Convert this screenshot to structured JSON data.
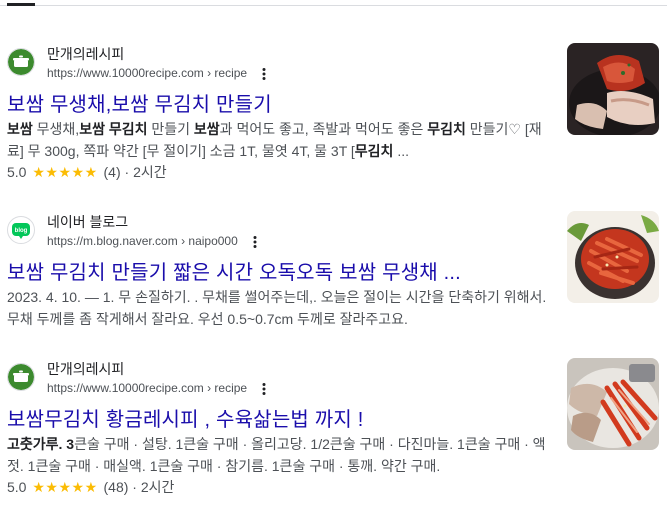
{
  "results": [
    {
      "site_name": "만개의레시피",
      "url": "https://www.10000recipe.com › recipe",
      "favicon": "recipe-pot-icon",
      "title": "보쌈 무생채,보쌈 무김치 만들기",
      "snippet_parts": [
        {
          "t": "보쌈",
          "b": true
        },
        {
          "t": " 무생채,",
          "b": false
        },
        {
          "t": "보쌈 무김치",
          "b": true
        },
        {
          "t": " 만들기 ",
          "b": false
        },
        {
          "t": "보쌈",
          "b": true
        },
        {
          "t": "과 먹어도 좋고, 족발과 먹어도 좋은 ",
          "b": false
        },
        {
          "t": "무김치",
          "b": true
        },
        {
          "t": " 만들기♡ [재료] 무 300g, 쪽파 약간 [무 절이기] 소금 1T, 물엿 4T, 물 3T [",
          "b": false
        },
        {
          "t": "무김치",
          "b": true
        },
        {
          "t": " ...",
          "b": false
        }
      ],
      "rating": "5.0",
      "stars": "★★★★★",
      "reviews": "(4) · 2시간",
      "thumbnail": "bossam-kimchi-photo"
    },
    {
      "site_name": "네이버 블로그",
      "url": "https://m.blog.naver.com › naipo000",
      "favicon": "naver-blog-icon",
      "favicon_text": "blog",
      "title": "보쌈 무김치 만들기 짧은 시간 오독오독 보쌈 무생채 ...",
      "snippet_parts": [
        {
          "t": "2023. 4. 10. — 1. 무 손질하기. . 무채를 썰어주는데,. 오늘은 절이는 시간을 단축하기 위해서. 무채 두께를 좀 작게해서 잘라요. 우선 0.5~0.7cm 두께로 잘라주고요.",
          "b": false
        }
      ],
      "thumbnail": "radish-kimchi-bowl-photo"
    },
    {
      "site_name": "만개의레시피",
      "url": "https://www.10000recipe.com › recipe",
      "favicon": "recipe-pot-icon",
      "title": "보쌈무김치 황금레시피 , 수육삶는법 까지 !",
      "snippet_parts": [
        {
          "t": "고춧가루. 3",
          "b": true
        },
        {
          "t": "큰술 구매 · 설탕. 1큰술 구매 · 올리고당. 1/2큰술 구매 · 다진마늘. 1큰술 구매 · 액젓. 1큰술 구매 · 매실액. 1큰술 구매 · 참기름. 1큰술 구매 · 통깨. 약간 구매.",
          "b": false
        }
      ],
      "rating": "5.0",
      "stars": "★★★★★",
      "reviews": "(48) · 2시간",
      "thumbnail": "suyuk-kimchi-plate-photo"
    }
  ],
  "colors": {
    "link": "#1a0dab",
    "snippet": "#4d5156",
    "star": "#fbbc04",
    "naver_green": "#03c75a",
    "recipe_green": "#3c8a2e"
  }
}
